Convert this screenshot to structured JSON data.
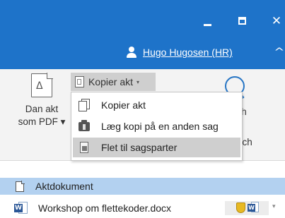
{
  "window": {
    "minimize_icon": "minimize-icon",
    "maximize_icon": "maximize-icon",
    "close_icon": "close-icon",
    "close_glyph": "✕",
    "accent_color": "#1e73c9"
  },
  "user": {
    "name": "Hugo Hugosen (HR)",
    "icon": "user-icon",
    "chevron_glyph": "^"
  },
  "ribbon": {
    "dan_akt": {
      "label_line1": "Dan akt",
      "label_line2": "som PDF ▾",
      "icon": "pdf-icon"
    },
    "kopier_akt": {
      "label": "Kopier akt",
      "caret": "▾",
      "icon": "copy-document-icon"
    },
    "search": {
      "label_partial": "rch",
      "label_partial_2": "rch",
      "icon": "search-icon"
    }
  },
  "dropdown": {
    "items": [
      {
        "label": "Kopier akt",
        "icon": "copy-icon",
        "highlighted": false
      },
      {
        "label": "Læg kopi på en anden sag",
        "icon": "folder-icon",
        "highlighted": false
      },
      {
        "label": "Flet til sagsparter",
        "icon": "merge-icon",
        "highlighted": true
      }
    ]
  },
  "list": {
    "header": {
      "label": "Aktdokument",
      "icon": "page-icon"
    },
    "rows": [
      {
        "label": "Workshop om flettekoder.docx",
        "icon": "word-icon",
        "status_icons": [
          "shield-icon",
          "word-icon"
        ],
        "caret": "▾"
      }
    ]
  },
  "colors": {
    "title_bar": "#1e73c9",
    "list_header": "#b3d1f0",
    "highlight": "#cfcfcf"
  }
}
